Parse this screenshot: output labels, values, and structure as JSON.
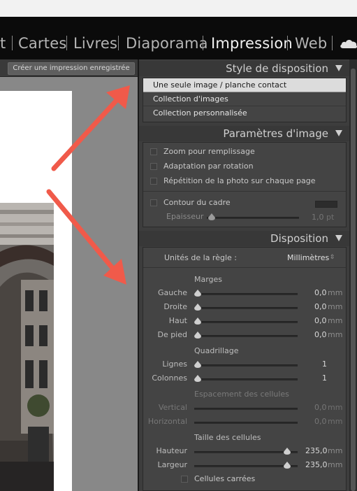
{
  "modules": [
    {
      "label": "t",
      "active": false
    },
    {
      "label": "Cartes",
      "active": false
    },
    {
      "label": "Livres",
      "active": false
    },
    {
      "label": "Diaporama",
      "active": false
    },
    {
      "label": "Impression",
      "active": true
    },
    {
      "label": "Web",
      "active": false
    }
  ],
  "toolbar": {
    "save_print_label": "Créer une impression enregistrée"
  },
  "layout_style": {
    "title": "Style de disposition",
    "items": [
      {
        "label": "Une seule image / planche contact",
        "selected": true
      },
      {
        "label": "Collection d'images",
        "selected": false
      },
      {
        "label": "Collection personnalisée",
        "selected": false
      }
    ]
  },
  "image_settings": {
    "title": "Paramètres d'image",
    "options": [
      {
        "label": "Zoom pour remplissage",
        "checked": false
      },
      {
        "label": "Adaptation par rotation",
        "checked": false
      },
      {
        "label": "Répétition de la photo sur chaque page",
        "checked": false
      }
    ],
    "stroke": {
      "label": "Contour du cadre",
      "checked": false,
      "width_label": "Epaisseur",
      "width_value": "1,0",
      "width_unit": "pt",
      "width_fraction": 0.0
    }
  },
  "layout": {
    "title": "Disposition",
    "ruler_units_label": "Unités de la règle :",
    "ruler_units_value": "Millimètres",
    "margins": {
      "title": "Marges",
      "rows": [
        {
          "label": "Gauche",
          "value": "0,0",
          "unit": "mm",
          "fraction": 0.0
        },
        {
          "label": "Droite",
          "value": "0,0",
          "unit": "mm",
          "fraction": 0.0
        },
        {
          "label": "Haut",
          "value": "0,0",
          "unit": "mm",
          "fraction": 0.0
        },
        {
          "label": "De pied",
          "value": "0,0",
          "unit": "mm",
          "fraction": 0.0
        }
      ]
    },
    "grid": {
      "title": "Quadrillage",
      "rows": [
        {
          "label": "Lignes",
          "value": "1",
          "fraction": 0.0
        },
        {
          "label": "Colonnes",
          "value": "1",
          "fraction": 0.0
        }
      ]
    },
    "spacing": {
      "title": "Espacement des cellules",
      "rows": [
        {
          "label": "Vertical",
          "value": "0,0",
          "unit": "mm"
        },
        {
          "label": "Horizontal",
          "value": "0,0",
          "unit": "mm"
        }
      ]
    },
    "cell_size": {
      "title": "Taille des cellules",
      "rows": [
        {
          "label": "Hauteur",
          "value": "235,0",
          "unit": "mm",
          "fraction": 0.88
        },
        {
          "label": "Largeur",
          "value": "235,0",
          "unit": "mm",
          "fraction": 0.88
        }
      ],
      "square_label": "Cellules carrées",
      "square_checked": false
    }
  },
  "colors": {
    "accent_arrow": "#f05a4a",
    "panel": "#3d3d3d",
    "selection": "#dcdcdc"
  },
  "icons": {
    "cloud": "cloud-icon",
    "collapse": "triangle-down-icon",
    "thumb": "slider-thumb-icon"
  }
}
